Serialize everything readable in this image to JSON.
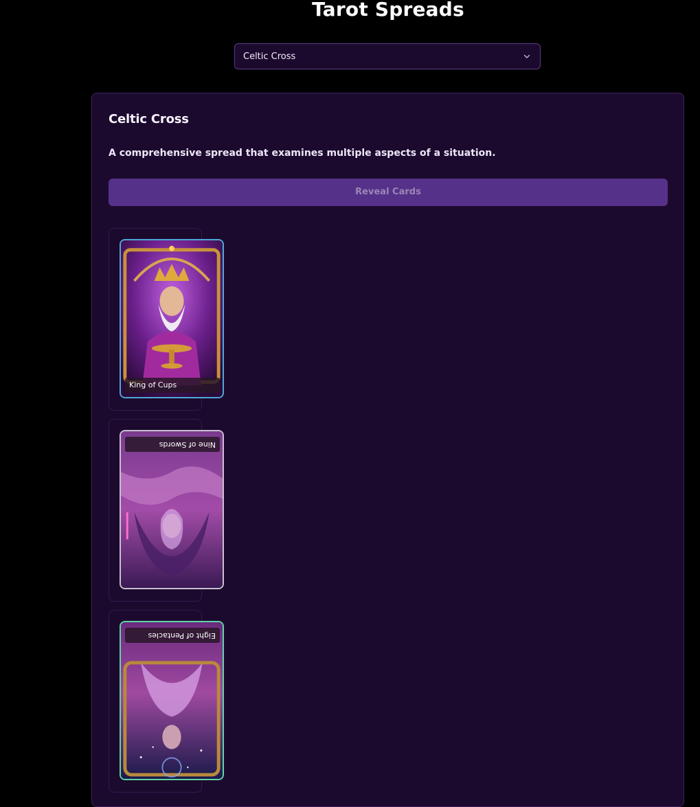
{
  "page": {
    "title": "Tarot Spreads"
  },
  "spread_select": {
    "selected": "Celtic Cross",
    "icon": "chevron-down-icon"
  },
  "spread": {
    "title": "Celtic Cross",
    "description": "A comprehensive spread that examines multiple aspects of a situation.",
    "reveal_label": "Reveal Cards"
  },
  "cards": [
    {
      "name": "King of Cups",
      "orientation": "upright",
      "border_color": "#4fa8d8"
    },
    {
      "name": "Nine of Swords",
      "orientation": "reversed",
      "border_color": "#c9c2cf"
    },
    {
      "name": "Eight of Pentacles",
      "orientation": "reversed",
      "border_color": "#5fd6a8"
    }
  ],
  "colors": {
    "background": "#000000",
    "panel": "#1c0a2e",
    "button": "#56318a",
    "button_text": "#9a86b6"
  }
}
